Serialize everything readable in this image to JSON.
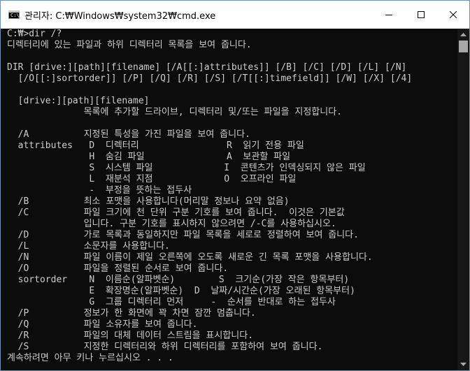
{
  "window": {
    "title": "관리자: C:₩Windows₩system32₩cmd.exe",
    "icon_label": "C:\\"
  },
  "controls": {
    "minimize_icon": "minimize-icon",
    "maximize_icon": "maximize-icon",
    "close_icon": "close-icon"
  },
  "console": {
    "lines": [
      "C:₩>dir /?",
      "디렉터리에 있는 파일과 하위 디렉터리 목록을 보여 줍니다.",
      "",
      "DIR [drive:][path][filename] [/A[[:]attributes]] [/B] [/C] [/D] [/L] [/N]",
      "  [/O[[:]sortorder]] [/P] [/Q] [/R] [/S] [/T[[:]timefield]] [/W] [/X] [/4]",
      "",
      "  [drive:][path][filename]",
      "              목록에 추가할 드라이브, 디렉터리 및/또는 파일을 지정합니다.",
      "",
      "  /A          지정된 특성을 가진 파일을 보여 줍니다.",
      "  attributes   D  디렉터리                R  읽기 전용 파일",
      "               H  숨김 파일               A  보관할 파일",
      "               S  시스템 파일             I  콘텐츠가 인덱싱되지 않은 파일",
      "               L  재분석 지점             O  오프라인 파일",
      "               -  부정을 뜻하는 접두사",
      "  /B          최소 포맷을 사용합니다(머리말 정보나 요약 없음)",
      "  /C          파일 크기에 천 단위 구분 기호를 보여 줍니다.  이것은 기본값",
      "              입니다. 구분 기호를 표시하지 않으려면 /-C를 사용하십시오.",
      "  /D          가로 목록과 동일하지만 파일 목록을 세로로 정렬하여 보여 줍니다.",
      "  /L          소문자를 사용합니다.",
      "  /N          파일 이름이 제일 오른쪽에 오도록 새로운 긴 목록 포맷을 사용합니다.",
      "  /O          파일을 정렬된 순서로 보여 줍니다.",
      "  sortorder    N  이름순(알파벳순)        S  크기순(가장 작은 항목부터)",
      "               E  확장명순(알파벳순)  D  날짜/시간순(가장 오래된 항목부터)",
      "               G  그룹 디렉터리 먼저     -  순서를 반대로 하는 접두사",
      "  /P          정보가 한 화면에 꽉 차면 잠깐 멈춥니다.",
      "  /Q          파일 소유자를 보여 줍니다.",
      "  /R          파일의 대체 데이터 스트림을 표시합니다.",
      "  /S          지정한 디렉터리와 하위 디렉터리를 포함하여 보여 줍니다.",
      "계속하려면 아무 키나 누르십시오 . . ."
    ]
  },
  "colors": {
    "console_background": "#0c0c0c",
    "console_text": "#cccccc",
    "titlebar": "#ffffff",
    "window_border": "#6f8fb5"
  }
}
